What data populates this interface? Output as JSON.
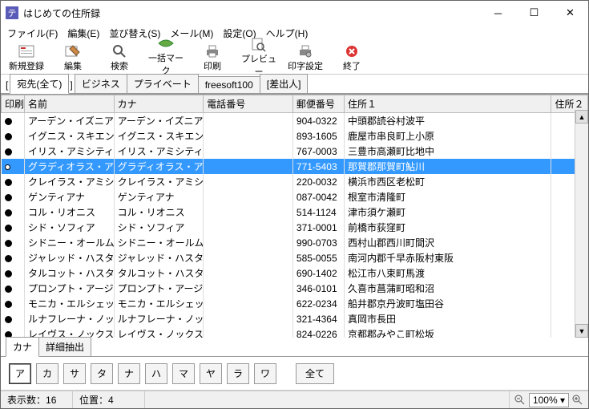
{
  "window": {
    "title": "はじめての住所録"
  },
  "menu": {
    "file": "ファイル(F)",
    "edit": "編集(E)",
    "sort": "並び替え(S)",
    "mail": "メール(M)",
    "settings": "設定(O)",
    "help": "ヘルプ(H)"
  },
  "toolbar": {
    "new": "新規登録",
    "edit": "編集",
    "search": "検索",
    "mark": "一括マーク",
    "print": "印刷",
    "preview": "プレビュー",
    "printset": "印字設定",
    "exit": "終了"
  },
  "tabs1": {
    "open": "[",
    "addr": "宛先(全て)",
    "close": "]",
    "biz": "ビジネス",
    "priv": "プライベート",
    "free": "freesoft100",
    "sender": "[差出人]"
  },
  "cols": {
    "print": "印刷",
    "name": "名前",
    "kana": "カナ",
    "tel": "電話番号",
    "zip": "郵便番号",
    "addr1": "住所１",
    "addr2": "住所２"
  },
  "rows": [
    {
      "p": "1",
      "name": "アーデン・イズニア",
      "kana": "アーデン・イズニア",
      "tel": "",
      "zip": "904-0322",
      "addr": "中頭郡読谷村波平"
    },
    {
      "p": "1",
      "name": "イグニス・スキエンティア",
      "kana": "イグニス・スキエンティア",
      "tel": "",
      "zip": "893-1605",
      "addr": "鹿屋市串良町上小原"
    },
    {
      "p": "1",
      "name": "イリス・アミシティア",
      "kana": "イリス・アミシティア",
      "tel": "",
      "zip": "767-0003",
      "addr": "三豊市高瀬町比地中"
    },
    {
      "p": "0",
      "name": "グラディオラス・アミシティア",
      "kana": "グラディオラス・アミシティア",
      "tel": "",
      "zip": "771-5403",
      "addr": "那賀郡那賀町鮎川",
      "sel": true
    },
    {
      "p": "1",
      "name": "クレイラス・アミシティア",
      "kana": "クレイラス・アミシティア",
      "tel": "",
      "zip": "220-0032",
      "addr": "横浜市西区老松町"
    },
    {
      "p": "1",
      "name": "ゲンティアナ",
      "kana": "ゲンティアナ",
      "tel": "",
      "zip": "087-0042",
      "addr": "根室市清隆町"
    },
    {
      "p": "1",
      "name": "コル・リオニス",
      "kana": "コル・リオニス",
      "tel": "",
      "zip": "514-1124",
      "addr": "津市須ケ瀬町"
    },
    {
      "p": "1",
      "name": "シド・ソフィア",
      "kana": "シド・ソフィア",
      "tel": "",
      "zip": "371-0001",
      "addr": "前橋市荻窪町"
    },
    {
      "p": "1",
      "name": "シドニー・オールム",
      "kana": "シドニー・オールム",
      "tel": "",
      "zip": "990-0703",
      "addr": "西村山郡西川町間沢"
    },
    {
      "p": "1",
      "name": "ジャレッド・ハスタ",
      "kana": "ジャレッド・ハスタ",
      "tel": "",
      "zip": "585-0055",
      "addr": "南河内郡千早赤阪村東阪"
    },
    {
      "p": "1",
      "name": "タルコット・ハスタ",
      "kana": "タルコット・ハスタ",
      "tel": "",
      "zip": "690-1402",
      "addr": "松江市八束町馬渡"
    },
    {
      "p": "1",
      "name": "プロンプト・アージェンタム",
      "kana": "プロンプト・アージェンタム",
      "tel": "",
      "zip": "346-0101",
      "addr": "久喜市菖蒲町昭和沼"
    },
    {
      "p": "1",
      "name": "モニカ・エルシェット",
      "kana": "モニカ・エルシェット",
      "tel": "",
      "zip": "622-0234",
      "addr": "船井郡京丹波町塩田谷"
    },
    {
      "p": "1",
      "name": "ルナフレーナ・ノックス・フルーレ",
      "kana": "ルナフレーナ・ノックス・フルーレ",
      "tel": "",
      "zip": "321-4364",
      "addr": "真岡市長田"
    },
    {
      "p": "1",
      "name": "レイヴス・ノックス・フルーレ",
      "kana": "レイヴス・ノックス・フルーレ",
      "tel": "",
      "zip": "824-0226",
      "addr": "京都郡みやこ町松坂"
    }
  ],
  "tabs2": {
    "kana": "カナ",
    "detail": "詳細抽出"
  },
  "kana": {
    "a": "ア",
    "ka": "カ",
    "sa": "サ",
    "ta": "タ",
    "na": "ナ",
    "ha": "ハ",
    "ma": "マ",
    "ya": "ヤ",
    "ra": "ラ",
    "wa": "ワ",
    "all": "全て"
  },
  "status": {
    "count_label": "表示数：",
    "count": "16",
    "pos_label": "位置：",
    "pos": "4",
    "zoom": "100%"
  }
}
